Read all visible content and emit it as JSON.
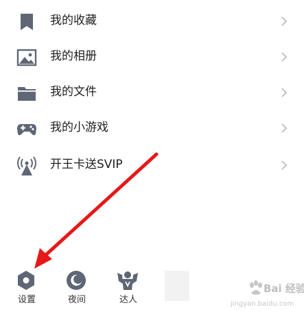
{
  "menu": {
    "items": [
      {
        "label": "我的收藏",
        "icon": "bookmark-icon"
      },
      {
        "label": "我的相册",
        "icon": "album-icon"
      },
      {
        "label": "我的文件",
        "icon": "folder-icon"
      },
      {
        "label": "我的小游戏",
        "icon": "gamepad-icon"
      },
      {
        "label": "开王卡送SVIP",
        "icon": "signal-tower-icon"
      }
    ]
  },
  "bottom_bar": {
    "settings_label": "设置",
    "night_label": "夜间",
    "expert_label": "达人"
  },
  "watermark": {
    "brand": "Bai 经验",
    "url": "jingyan.baidu.com"
  },
  "colors": {
    "icon_gray": "#5f6675",
    "chevron": "#b8b8b8",
    "arrow_red": "#e5191a"
  }
}
